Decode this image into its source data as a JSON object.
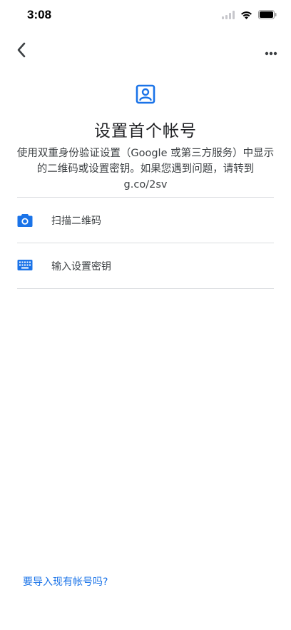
{
  "status_bar": {
    "time": "3:08"
  },
  "nav": {
    "back_icon": "chevron-left-icon",
    "more_icon": "more-horiz-icon"
  },
  "header": {
    "icon": "account-box-icon",
    "title": "设置首个帐号",
    "description": "使用双重身份验证设置（Google 或第三方服务）中显示的二维码或设置密钥。如果您遇到问题，请转到 g.co/2sv"
  },
  "options": [
    {
      "icon": "camera-icon",
      "label": "扫描二维码"
    },
    {
      "icon": "keyboard-icon",
      "label": "输入设置密钥"
    }
  ],
  "footer": {
    "import_link": "要导入现有帐号吗?"
  },
  "colors": {
    "accent": "#1a73e8",
    "text_primary": "#202124",
    "text_secondary": "#3c4043",
    "divider": "#dadce0"
  }
}
